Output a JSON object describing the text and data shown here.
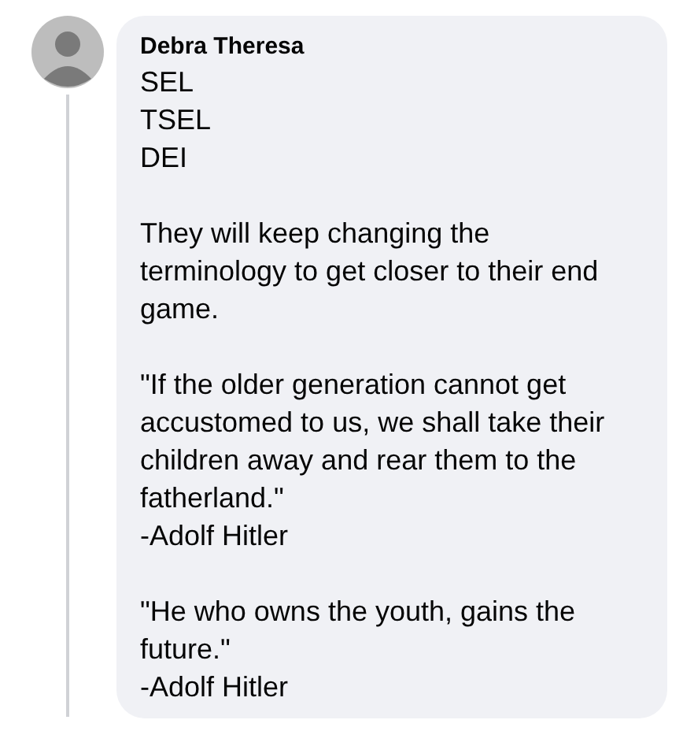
{
  "comment": {
    "author": "Debra Theresa",
    "paragraphs": [
      {
        "lines": [
          "SEL",
          "TSEL",
          "DEI"
        ]
      },
      {
        "lines": [
          "They will keep changing the",
          "terminology to get closer to their end",
          "game."
        ]
      },
      {
        "lines": [
          "\"If the older generation cannot get",
          "accustomed to us, we shall take their",
          "children away and rear them to the",
          "fatherland.\"",
          "-Adolf Hitler"
        ]
      },
      {
        "lines": [
          "\"He who owns the youth, gains the",
          "future.\"",
          "-Adolf Hitler"
        ]
      }
    ]
  }
}
